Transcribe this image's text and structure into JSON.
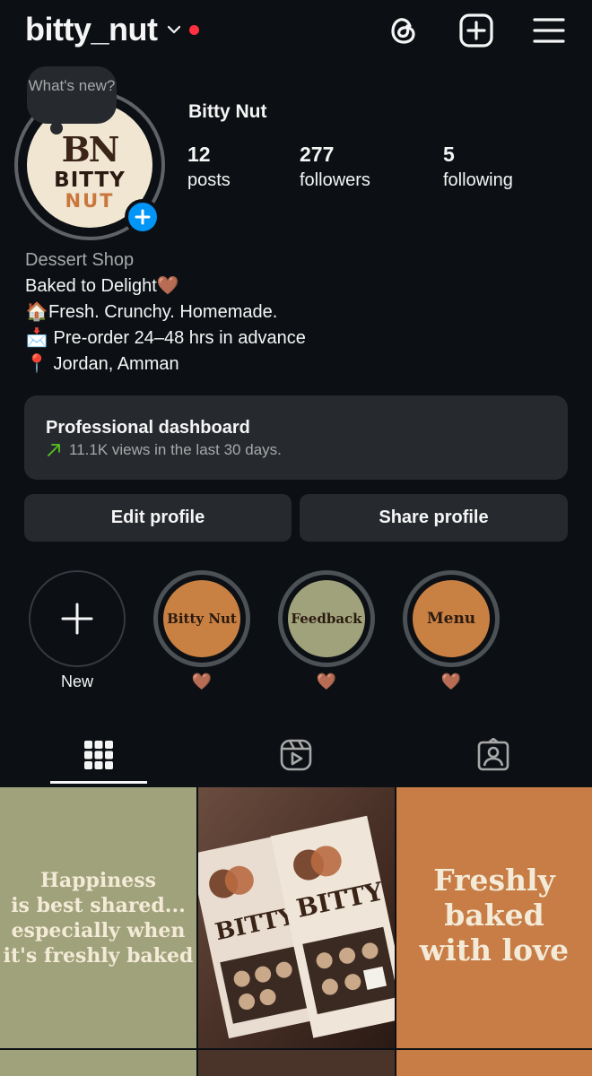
{
  "header": {
    "username": "bitty_nut",
    "icons": [
      "threads-icon",
      "create-post-icon",
      "menu-icon"
    ]
  },
  "note": {
    "text": "What's new?"
  },
  "avatar": {
    "logo_mark": "BN",
    "logo_word1": "BITTY",
    "logo_word2": "NUT"
  },
  "profile": {
    "display_name": "Bitty Nut",
    "stats": [
      {
        "value": "12",
        "label": "posts"
      },
      {
        "value": "277",
        "label": "followers"
      },
      {
        "value": "5",
        "label": "following"
      }
    ]
  },
  "bio": {
    "category": "Dessert Shop",
    "line1": "Baked to Delight🤎",
    "line2_emoji": "🏠",
    "line2": "Fresh. Crunchy. Homemade.",
    "line3_emoji": "📩",
    "line3": " Pre-order 24–48 hrs in advance",
    "line4_emoji": "📍",
    "line4": " Jordan, Amman"
  },
  "dashboard": {
    "title": "Professional dashboard",
    "subtitle": "11.1K views in the last 30 days."
  },
  "buttons": {
    "edit": "Edit profile",
    "share": "Share profile"
  },
  "highlights": [
    {
      "label": "New",
      "cover_text": ""
    },
    {
      "label": "🤎",
      "cover_text": "Bitty Nut",
      "color": "#c98043"
    },
    {
      "label": "🤎",
      "cover_text": "Feedback",
      "color": "#9fa27a"
    },
    {
      "label": "🤎",
      "cover_text": "Menu",
      "color": "#c98043"
    }
  ],
  "grid": {
    "post1": [
      "Happiness",
      "is best shared...",
      "especially when",
      "it's freshly baked"
    ],
    "post2": {
      "brand": "BITTY"
    },
    "post3": [
      "Freshly",
      "baked",
      "with love"
    ]
  },
  "colors": {
    "background": "#0c1014",
    "surface": "#262a2f",
    "accent": "#0095f6",
    "notification": "#ff3040",
    "green_trend": "#58c322",
    "sage": "#9fa27a",
    "caramel": "#c98043"
  }
}
